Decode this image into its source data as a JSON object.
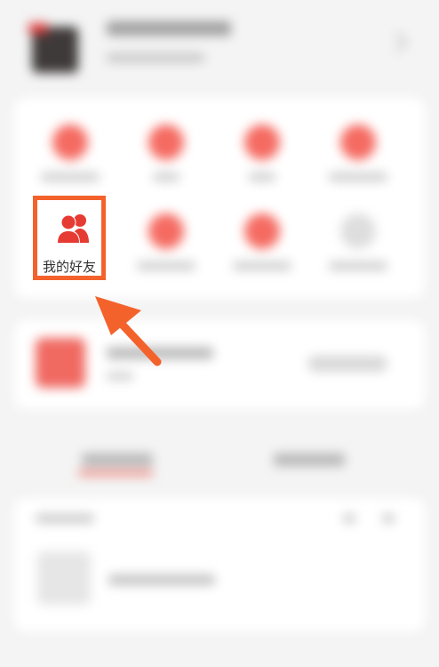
{
  "colors": {
    "accent": "#f4622c",
    "icon_red": "#e63b33",
    "background": "#f4f4f4",
    "card": "#ffffff"
  },
  "menu": {
    "friends": {
      "label": "我的好友",
      "icon": "friends-icon",
      "highlighted": true
    }
  },
  "annotation": {
    "arrow_color": "#f4622c",
    "arrow_icon": "arrow-pointer"
  }
}
